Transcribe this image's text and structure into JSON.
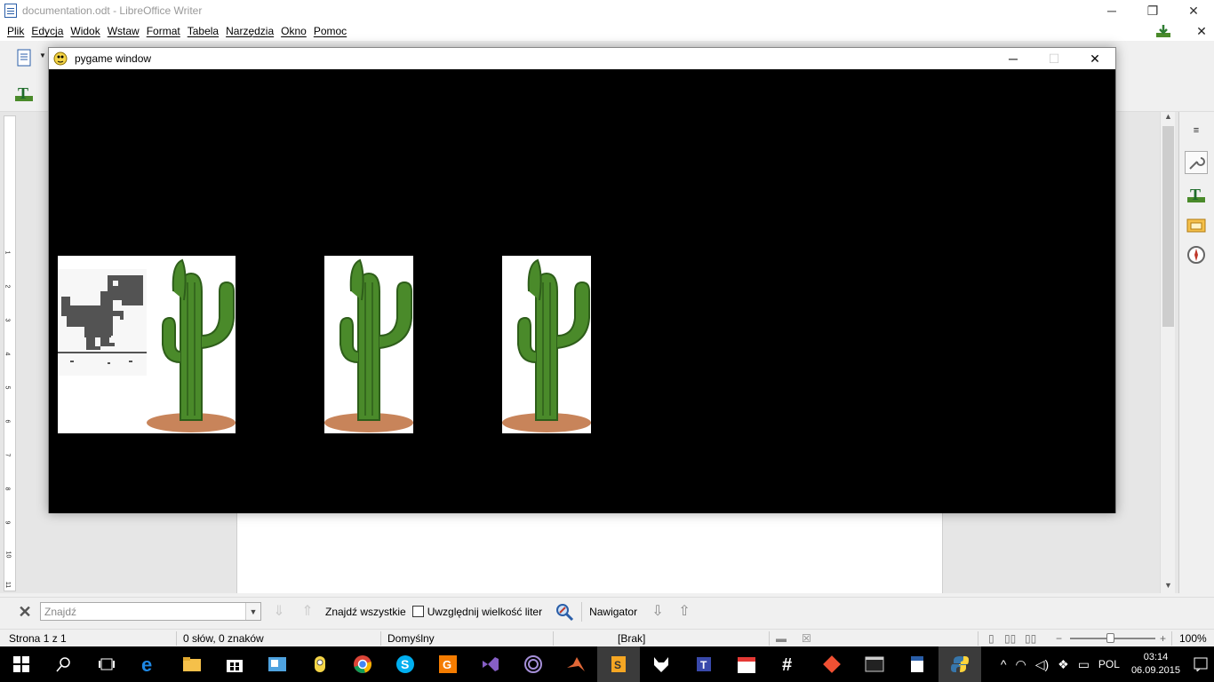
{
  "writer": {
    "window_title": "documentation.odt - LibreOffice Writer",
    "window_controls": {
      "minimize": "─",
      "maximize": "❐",
      "close": "✕"
    },
    "menu": [
      "Plik",
      "Edycja",
      "Widok",
      "Wstaw",
      "Format",
      "Tabela",
      "Narzędzia",
      "Okno",
      "Pomoc"
    ],
    "menu_close": "✕",
    "find_bar": {
      "placeholder": "Znajdź",
      "find_all_label": "Znajdź wszystkie",
      "match_case_label": "Uwzględnij wielkość liter",
      "match_case_checked": false,
      "navigator_label": "Nawigator"
    },
    "status": {
      "page": "Strona 1 z 1",
      "words": "0 słów, 0 znaków",
      "style": "Domyślny",
      "language": "[Brak]",
      "zoom": "100%"
    },
    "vruler_labels": [
      "1",
      "2",
      "3",
      "4",
      "5",
      "6",
      "7",
      "8",
      "9",
      "10",
      "11"
    ]
  },
  "pygame": {
    "window_title": "pygame window",
    "controls": {
      "minimize": "─",
      "maximize": "☐",
      "close": "✕"
    },
    "background": "#000000",
    "sprites": [
      {
        "kind": "dino-with-cactus"
      },
      {
        "kind": "cactus"
      },
      {
        "kind": "cactus"
      }
    ]
  },
  "taskbar": {
    "language": "POL",
    "time": "03:14",
    "date": "06.09.2015",
    "apps": [
      "start",
      "search",
      "task-view",
      "edge",
      "file-explorer",
      "store",
      "outlook",
      "minion",
      "chrome",
      "skype",
      "pdf",
      "visual-studio",
      "tor",
      "matlab",
      "sublime",
      "inkscape",
      "tray-app",
      "calendar",
      "slack",
      "git",
      "cmd",
      "writer",
      "python"
    ]
  },
  "colors": {
    "cactus": "#4a8a2a",
    "cactus_dark": "#2e5e1a",
    "sand": "#c8845a",
    "dino": "#535353"
  }
}
